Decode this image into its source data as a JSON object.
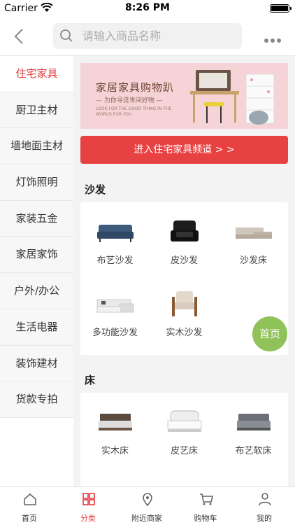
{
  "status_bar": {
    "carrier": "Carrier",
    "time": "8:26 PM"
  },
  "search": {
    "placeholder": "请输入商品名称",
    "value": ""
  },
  "sidebar": {
    "items": [
      {
        "label": "住宅家具",
        "active": true
      },
      {
        "label": "厨卫主材"
      },
      {
        "label": "墙地面主材"
      },
      {
        "label": "灯饰照明"
      },
      {
        "label": "家装五金"
      },
      {
        "label": "家居家饰"
      },
      {
        "label": "户外/办公"
      },
      {
        "label": "生活电器"
      },
      {
        "label": "装饰建材"
      },
      {
        "label": "货款专拍"
      }
    ]
  },
  "banner": {
    "title": "家居家具购物趴",
    "subtitle": "— 为你寻觅世间好物 —",
    "english": "LOOK FOR THE GOOD THING IN THE WORLD FOR YOU"
  },
  "enter_button": "进入住宅家具频道 > >",
  "sections": [
    {
      "title": "沙发",
      "items": [
        {
          "label": "布艺沙发",
          "icon": "sofa-fabric"
        },
        {
          "label": "皮沙发",
          "icon": "sofa-leather"
        },
        {
          "label": "沙发床",
          "icon": "sofa-bed"
        },
        {
          "label": "多功能沙发",
          "icon": "sofa-multi"
        },
        {
          "label": "实木沙发",
          "icon": "sofa-wood"
        }
      ]
    },
    {
      "title": "床",
      "items": [
        {
          "label": "实木床",
          "icon": "bed-wood"
        },
        {
          "label": "皮艺床",
          "icon": "bed-leather"
        },
        {
          "label": "布艺软床",
          "icon": "bed-fabric"
        }
      ]
    }
  ],
  "fab": {
    "label": "首页"
  },
  "tabbar": {
    "tabs": [
      {
        "label": "首页",
        "icon": "home-icon"
      },
      {
        "label": "分类",
        "icon": "category-icon",
        "active": true
      },
      {
        "label": "附近商家",
        "icon": "nearby-icon"
      },
      {
        "label": "购物车",
        "icon": "cart-icon"
      },
      {
        "label": "我的",
        "icon": "profile-icon"
      }
    ]
  },
  "colors": {
    "accent": "#e4393c",
    "button": "#e84142",
    "fab": "#8bbf52"
  }
}
